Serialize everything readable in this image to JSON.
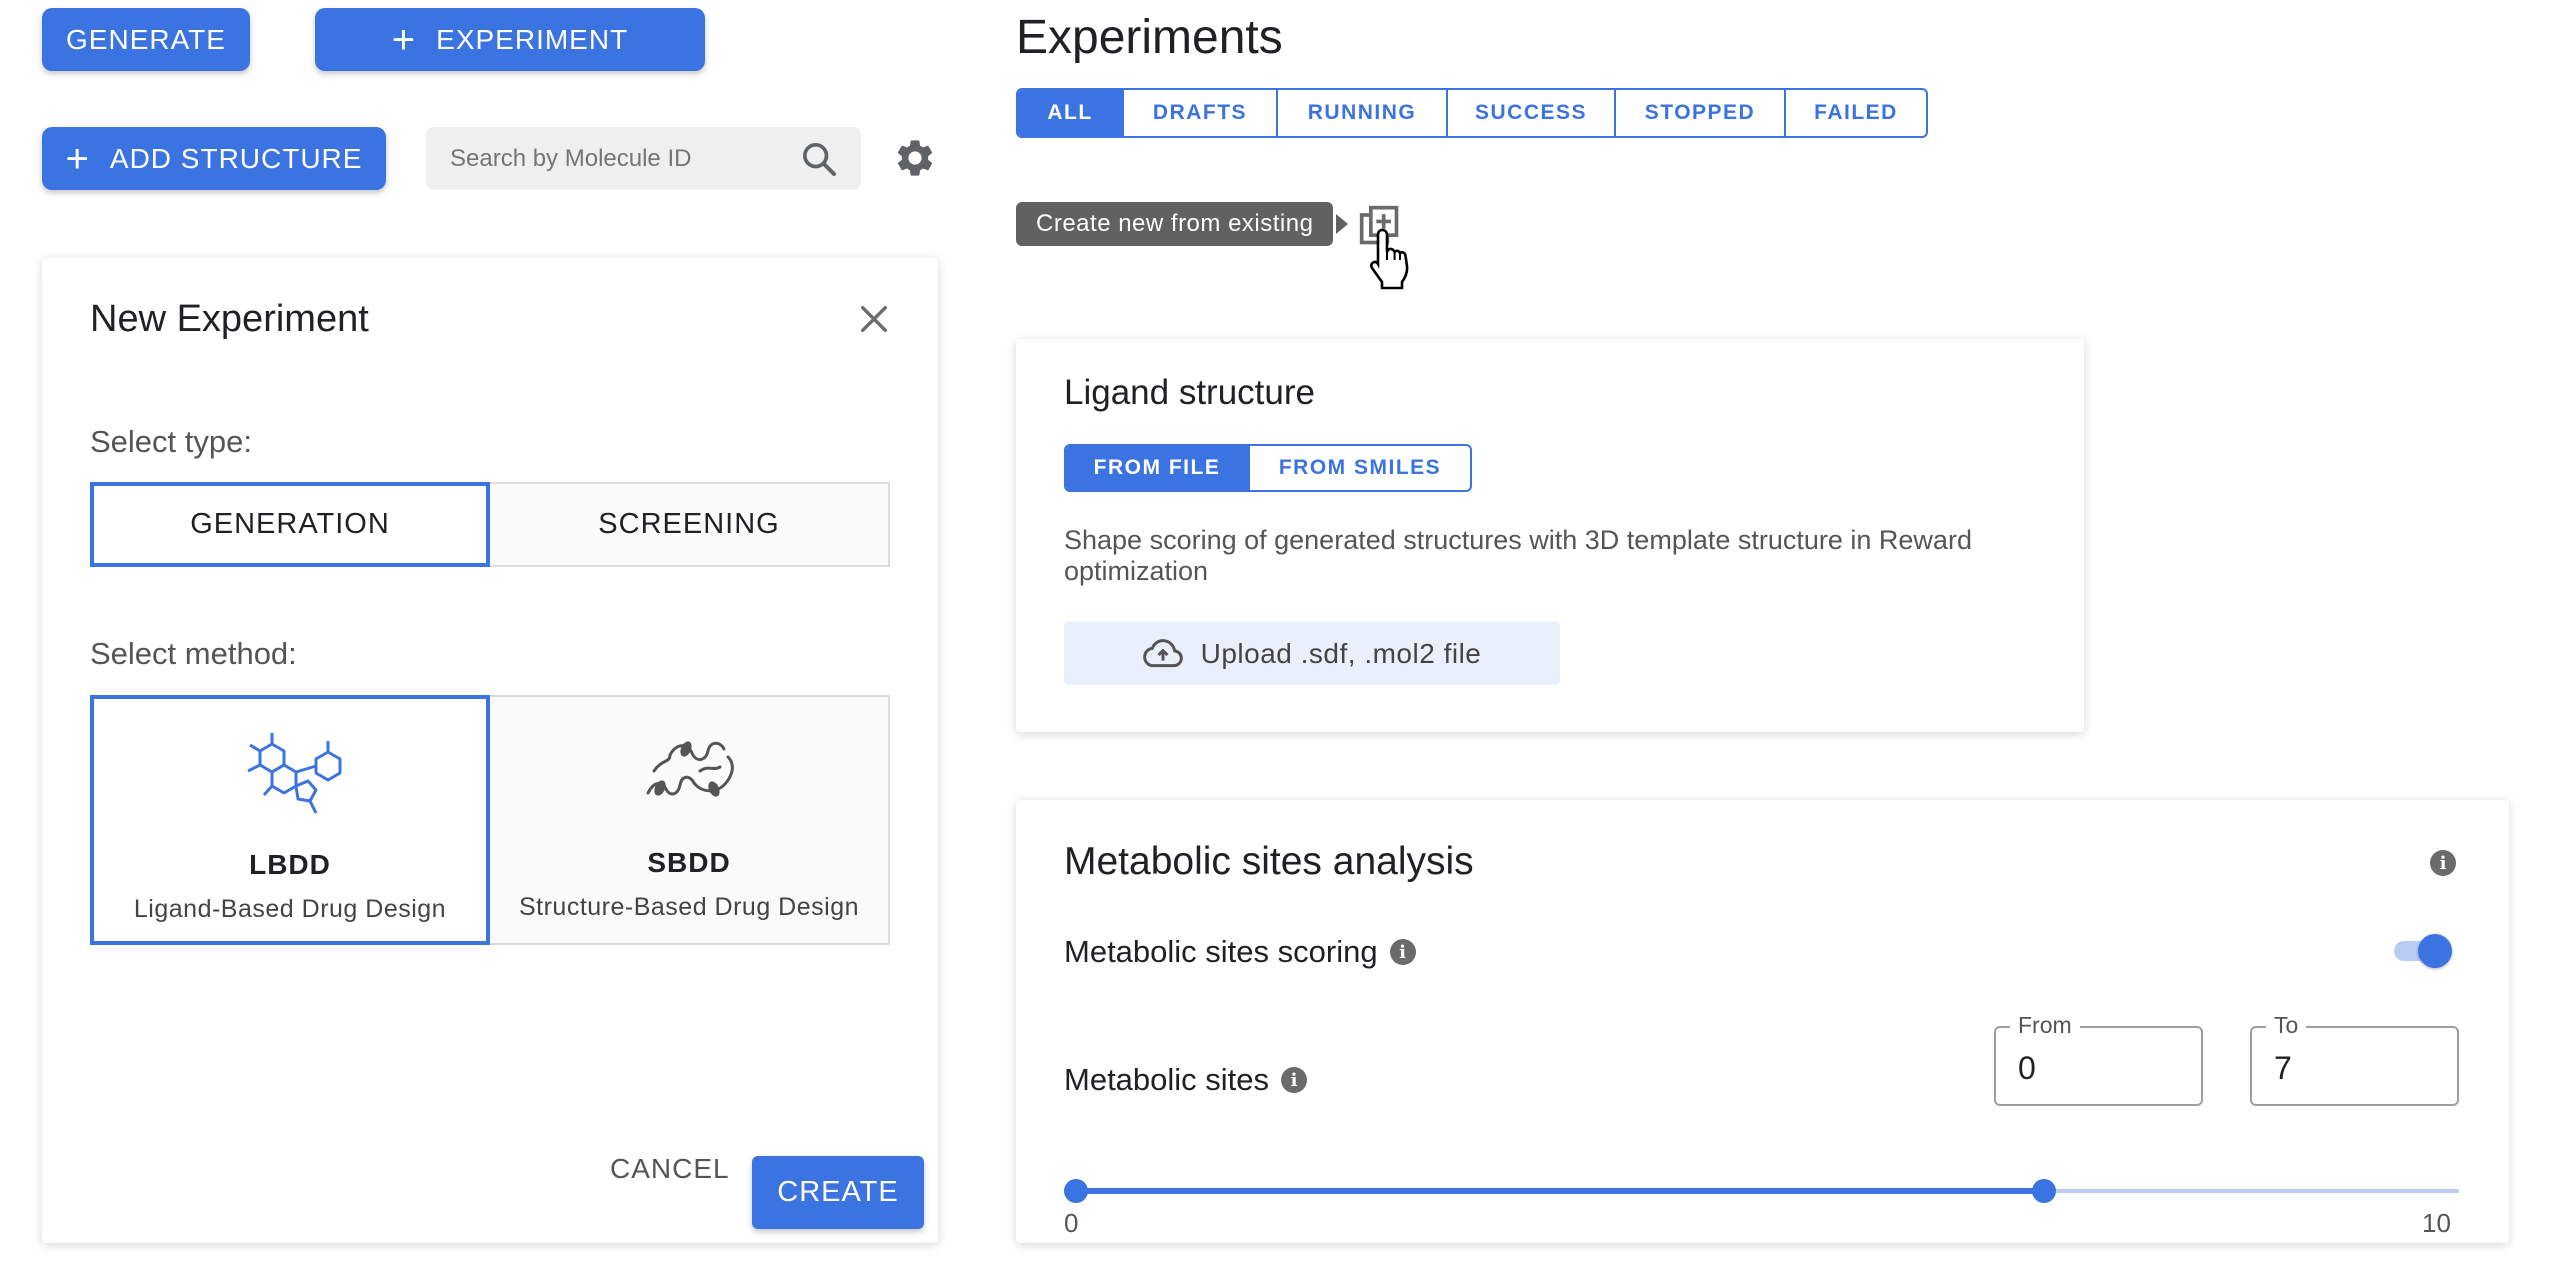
{
  "header": {
    "generate_label": "GENERATE",
    "experiment_label": "EXPERIMENT",
    "add_structure_label": "ADD STRUCTURE",
    "search_placeholder": "Search by Molecule ID"
  },
  "experiments": {
    "title": "Experiments",
    "tabs": [
      {
        "label": "ALL",
        "active": true
      },
      {
        "label": "DRAFTS"
      },
      {
        "label": "RUNNING"
      },
      {
        "label": "SUCCESS"
      },
      {
        "label": "STOPPED"
      },
      {
        "label": "FAILED"
      }
    ],
    "tooltip": "Create new from existing"
  },
  "new_experiment": {
    "title": "New Experiment",
    "select_type_label": "Select type:",
    "types": [
      "GENERATION",
      "SCREENING"
    ],
    "select_method_label": "Select method:",
    "methods": [
      {
        "code": "LBDD",
        "name": "Ligand-Based Drug Design"
      },
      {
        "code": "SBDD",
        "name": "Structure-Based Drug Design"
      }
    ],
    "cancel_label": "CANCEL",
    "create_label": "CREATE"
  },
  "ligand": {
    "title": "Ligand structure",
    "tabs": [
      "FROM FILE",
      "FROM SMILES"
    ],
    "description": "Shape scoring of generated structures with 3D template structure in Reward optimization",
    "upload_label": "Upload .sdf, .mol2 file"
  },
  "metabolic": {
    "title": "Metabolic sites analysis",
    "scoring_label": "Metabolic sites scoring",
    "scoring_enabled": true,
    "sites_label": "Metabolic sites",
    "from_label": "From",
    "from_value": "0",
    "to_label": "To",
    "to_value": "7",
    "range_min": "0",
    "range_max": "10",
    "range_low_value": 0,
    "range_high_value": 7
  },
  "colors": {
    "accent": "#3b73e0",
    "track_light": "#b9cdf4"
  }
}
